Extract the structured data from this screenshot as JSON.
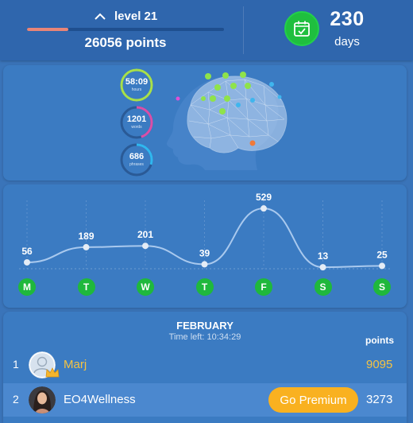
{
  "stats": {
    "level_label": "level 21",
    "level_progress": 0.21,
    "points_label": "26056 points",
    "days_value": "230",
    "days_label": "days"
  },
  "brain_stats": [
    {
      "value": "58:09",
      "unit": "hours",
      "color": "#a8e04a",
      "fraction": 1.0
    },
    {
      "value": "1201",
      "unit": "words",
      "color": "#d94fa8",
      "fraction": 0.45
    },
    {
      "value": "686",
      "unit": "phrases",
      "color": "#2fb7ef",
      "fraction": 0.3
    }
  ],
  "chart_data": {
    "type": "line",
    "categories": [
      "M",
      "T",
      "W",
      "T",
      "F",
      "S",
      "S"
    ],
    "values": [
      56,
      189,
      201,
      39,
      529,
      13,
      25
    ],
    "ylim": [
      0,
      600
    ],
    "grid": "vertical dotted",
    "title": "",
    "xlabel": "",
    "ylabel": ""
  },
  "leaderboard": {
    "month": "FEBRUARY",
    "time_left": "Time left: 10:34:29",
    "points_header": "points",
    "rows": [
      {
        "rank": "1",
        "name": "Marj",
        "points": "9095"
      },
      {
        "rank": "2",
        "name": "EO4Wellness",
        "points": "3273",
        "button": "Go Premium"
      }
    ]
  },
  "colors": {
    "accent_green": "#1fb83c",
    "gold": "#f5c342",
    "premium": "#f9b120",
    "progress": "#e98577"
  }
}
